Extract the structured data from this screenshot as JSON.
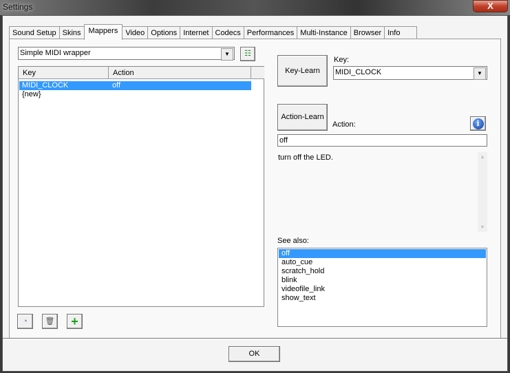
{
  "window": {
    "title": "Settings",
    "close": "X"
  },
  "tabs": [
    "Sound Setup",
    "Skins",
    "Mappers",
    "Video",
    "Options",
    "Internet",
    "Codecs",
    "Performances",
    "Multi-Instance",
    "Browser",
    "Info"
  ],
  "active_tab": "Mappers",
  "mapper_select": {
    "value": "Simple MIDI wrapper"
  },
  "mappings": {
    "columns": [
      "Key",
      "Action"
    ],
    "rows": [
      {
        "key": "MIDI_CLOCK",
        "action": "off"
      },
      {
        "key": "{new}",
        "action": ""
      }
    ]
  },
  "right": {
    "key_learn": "Key-Learn",
    "key_label": "Key:",
    "key_value": "MIDI_CLOCK",
    "action_learn": "Action-Learn",
    "action_label": "Action:",
    "action_value": "off",
    "description": "turn off the LED.",
    "see_also_label": "See also:",
    "see_also": [
      "off",
      "auto_cue",
      "scratch_hold",
      "blink",
      "videofile_link",
      "show_text"
    ]
  },
  "footer": {
    "ok": "OK"
  },
  "colors": {
    "selection": "#3399ff"
  }
}
